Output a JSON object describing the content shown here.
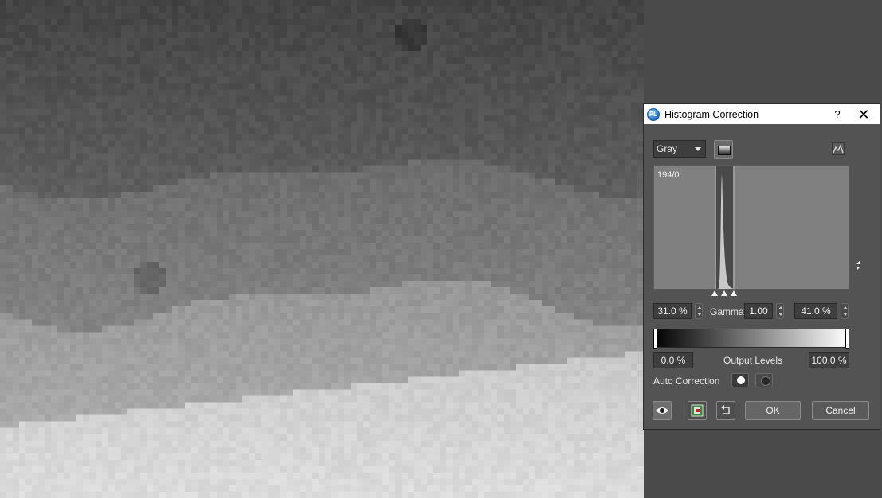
{
  "dialog": {
    "title": "Histogram Correction",
    "help_label": "?",
    "close_label": "✕"
  },
  "channel": {
    "selected": "Gray"
  },
  "histogram": {
    "value_label": "194/0",
    "peak_position_fraction": 0.345,
    "input_range_fraction": [
      0.31,
      0.41
    ]
  },
  "levels": {
    "input_low": "31.0 %",
    "gamma_label": "Gamma:",
    "gamma_value": "1.00",
    "input_high": "41.0 %",
    "output_low": "0.0 %",
    "output_label": "Output Levels",
    "output_high": "100.0 %"
  },
  "auto_correction": {
    "label": "Auto Correction"
  },
  "buttons": {
    "ok": "OK",
    "cancel": "Cancel"
  },
  "colors": {
    "dialog_bg": "#535353",
    "field_bg": "#3e3e3e",
    "histogram_bg": "#808080",
    "titlebar_bg": "#ffffff"
  },
  "icons": [
    "app-logo-icon",
    "gradient-icon",
    "histogram-icon",
    "eye-icon",
    "before-after-icon",
    "reset-icon"
  ]
}
